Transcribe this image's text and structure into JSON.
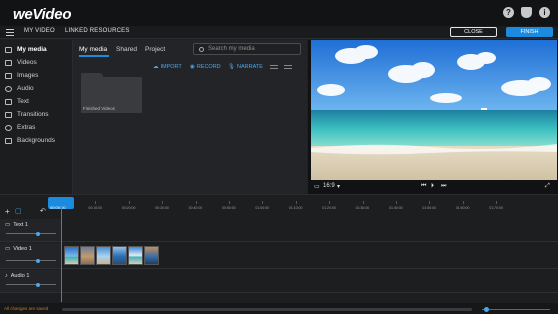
{
  "app": {
    "logo": "weVideo",
    "help_icon": "?",
    "notif_icon": "bell",
    "user_icon": "i"
  },
  "nav": {
    "tabs": [
      "MY VIDEO",
      "LINKED RESOURCES"
    ],
    "close_label": "CLOSE",
    "finish_label": "FINISH"
  },
  "sidebar": {
    "items": [
      {
        "label": "My media",
        "icon": "media-icon"
      },
      {
        "label": "Videos",
        "icon": "video-icon"
      },
      {
        "label": "Images",
        "icon": "image-icon"
      },
      {
        "label": "Audio",
        "icon": "audio-icon"
      },
      {
        "label": "Text",
        "icon": "text-icon"
      },
      {
        "label": "Transitions",
        "icon": "transition-icon"
      },
      {
        "label": "Extras",
        "icon": "extras-icon"
      },
      {
        "label": "Backgrounds",
        "icon": "backgrounds-icon"
      }
    ]
  },
  "media": {
    "tabs": [
      "My media",
      "Shared",
      "Project"
    ],
    "search_placeholder": "Search my media",
    "actions": [
      "IMPORT",
      "RECORD",
      "NARRATE"
    ],
    "folder_label": "Finished Videos"
  },
  "preview": {
    "aspect": "16:9",
    "accent": "#1b8be0"
  },
  "timeline": {
    "playhead_time": "00:00:00",
    "ruler": [
      "00:00:00",
      "00:10:00",
      "00:20:00",
      "00:30:00",
      "00:40:00",
      "00:50:00",
      "01:00:00",
      "01:10:00",
      "01:20:00",
      "01:30:00",
      "01:40:00",
      "01:50:00",
      "01:60:00",
      "01:70:00"
    ],
    "tracks": [
      {
        "name": "Text 1",
        "icon": "text-track-icon"
      },
      {
        "name": "Video 1",
        "icon": "video-track-icon"
      },
      {
        "name": "Audio 1",
        "icon": "audio-track-icon"
      }
    ],
    "status": "All changes are saved"
  }
}
